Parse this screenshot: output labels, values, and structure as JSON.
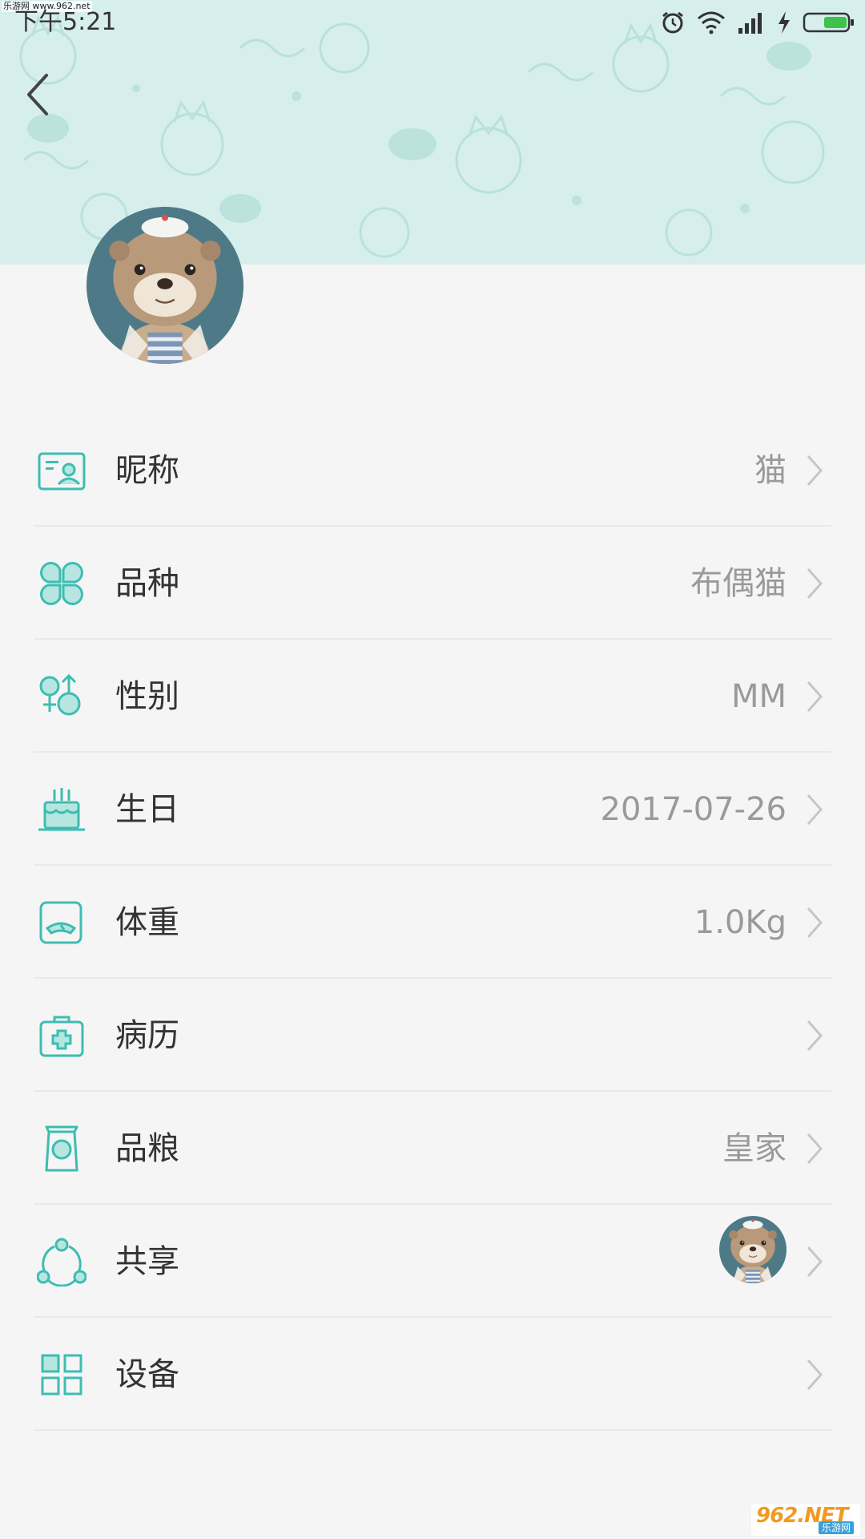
{
  "status_bar": {
    "watermark": "乐游网 www.962.net",
    "time": "下午5:21"
  },
  "colors": {
    "accent": "#3dbdb2",
    "header_bg": "#d6efec",
    "page_bg": "#f5f5f5",
    "value_text": "#9a9a9a"
  },
  "header": {
    "back_icon": "chevron-left-icon",
    "avatar_icon": "otter-avatar"
  },
  "items": [
    {
      "icon": "id-card-icon",
      "label": "昵称",
      "value": "猫"
    },
    {
      "icon": "clover-icon",
      "label": "品种",
      "value": "布偶猫"
    },
    {
      "icon": "gender-icon",
      "label": "性别",
      "value": "MM"
    },
    {
      "icon": "cake-icon",
      "label": "生日",
      "value": "2017-07-26"
    },
    {
      "icon": "scale-icon",
      "label": "体重",
      "value": "1.0Kg"
    },
    {
      "icon": "medical-kit-icon",
      "label": "病历",
      "value": ""
    },
    {
      "icon": "food-bag-icon",
      "label": "品粮",
      "value": "皇家"
    },
    {
      "icon": "share-icon",
      "label": "共享",
      "value": ""
    },
    {
      "icon": "grid-icon",
      "label": "设备",
      "value": ""
    }
  ],
  "watermark_bottom": {
    "logo": "962.NET",
    "sub": "乐游网"
  }
}
